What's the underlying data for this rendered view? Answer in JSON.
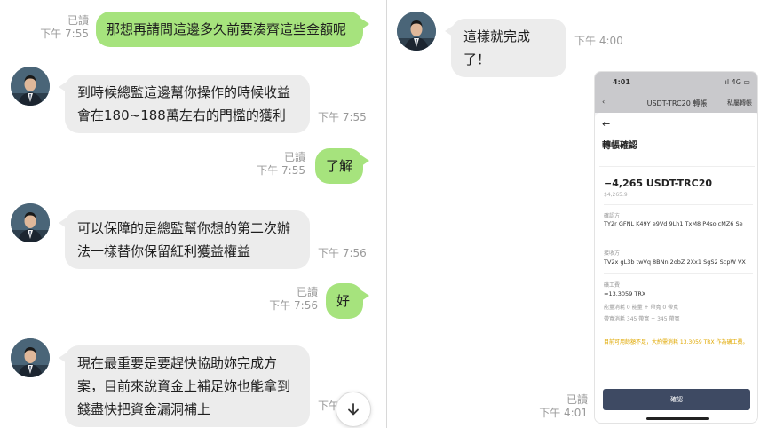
{
  "left_chat": {
    "messages": [
      {
        "side": "out",
        "text": "那想再請問這邊多久前要湊齊這些金額呢",
        "read": "已讀",
        "time": "下午 7:55"
      },
      {
        "side": "in",
        "lines": [
          "到時候總監這邊幫你操作的時候收益",
          "會在180~188萬左右的門檻的獲利"
        ],
        "time": "下午 7:55"
      },
      {
        "side": "out",
        "text": "了解",
        "read": "已讀",
        "time": "下午 7:55"
      },
      {
        "side": "in",
        "lines": [
          "可以保障的是總監幫你想的第二次辦",
          "法一樣替你保留紅利獲益權益"
        ],
        "time": "下午 7:56"
      },
      {
        "side": "out",
        "text": "好",
        "read": "已讀",
        "time": "下午 7:56"
      },
      {
        "side": "in",
        "lines": [
          "現在最重要是要趕快協助妳完成方",
          "案，目前來說資金上補足妳也能拿到",
          "錢盡快把資金漏洞補上"
        ],
        "time": "下午"
      }
    ]
  },
  "right_chat": {
    "message": {
      "text": "這樣就完成了！",
      "time": "下午 4:00"
    },
    "image_meta": {
      "read": "已讀",
      "time": "下午 4:01"
    }
  },
  "phone": {
    "status_time": "4:01",
    "status_signal": "ııl 4G ▭",
    "nav_title": "USDT-TRC20 轉帳",
    "nav_right": "私屬轉帳",
    "sheet_title": "轉帳確認",
    "amount": "−4,265 USDT-TRC20",
    "amount_sub": "$4,265.9",
    "from_label": "確認方",
    "from_addr": "TY2r GFNL K49Y e9Vd 9Lh1 TxM8 P4so cMZ6 Se",
    "to_label": "接收方",
    "to_addr": "TV2x gL3b twVq 8BNn 2obZ 2Xx1 SgS2 ScpW VX",
    "fee_label": "礦工費",
    "fee_value": "≈13.3059 TRX",
    "fee_line1": "能量消耗 0 能量 + 帶寬 0 帶寬",
    "fee_line2": "帶寬消耗 345 帶寬 + 345 帶寬",
    "warning": "目前可用餘額不足，大約需消耗 13.3059 TRX 作為礦工費。",
    "confirm_label": "確認"
  },
  "icons": {
    "scroll_down": "chevron-down-icon"
  }
}
